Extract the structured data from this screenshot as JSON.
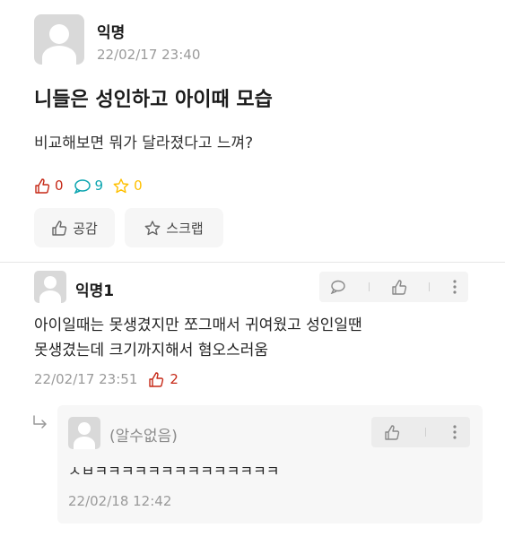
{
  "post": {
    "author": "익명",
    "date": "22/02/17 23:40",
    "title": "니들은 성인하고 아이때 모습",
    "body": "비교해보면 뭐가 달라졌다고 느껴?",
    "stats": {
      "likes": "0",
      "comments": "9",
      "scraps": "0"
    },
    "buttons": {
      "like_label": "공감",
      "scrap_label": "스크랩"
    }
  },
  "comment": {
    "author": "익명1",
    "line1": "아이일때는 못생겼지만 쪼그매서 귀여웠고 성인일땐",
    "line2": "못생겼는데 크기까지해서 혐오스러움",
    "date": "22/02/17 23:51",
    "likes": "2"
  },
  "reply": {
    "author": "(알수없음)",
    "text": "ㅅㅂㅋㅋㅋㅋㅋㅋㅋㅋㅋㅋㅋㅋㅋㅋ",
    "date": "22/02/18 12:42"
  },
  "colors": {
    "like": "#c62917",
    "comment": "#0ca5b0",
    "scrap": "#ffc000"
  },
  "icons": [
    "avatar-icon",
    "thumbs-up-icon",
    "comment-bubble-icon",
    "star-icon",
    "more-icon",
    "reply-arrow-icon"
  ]
}
